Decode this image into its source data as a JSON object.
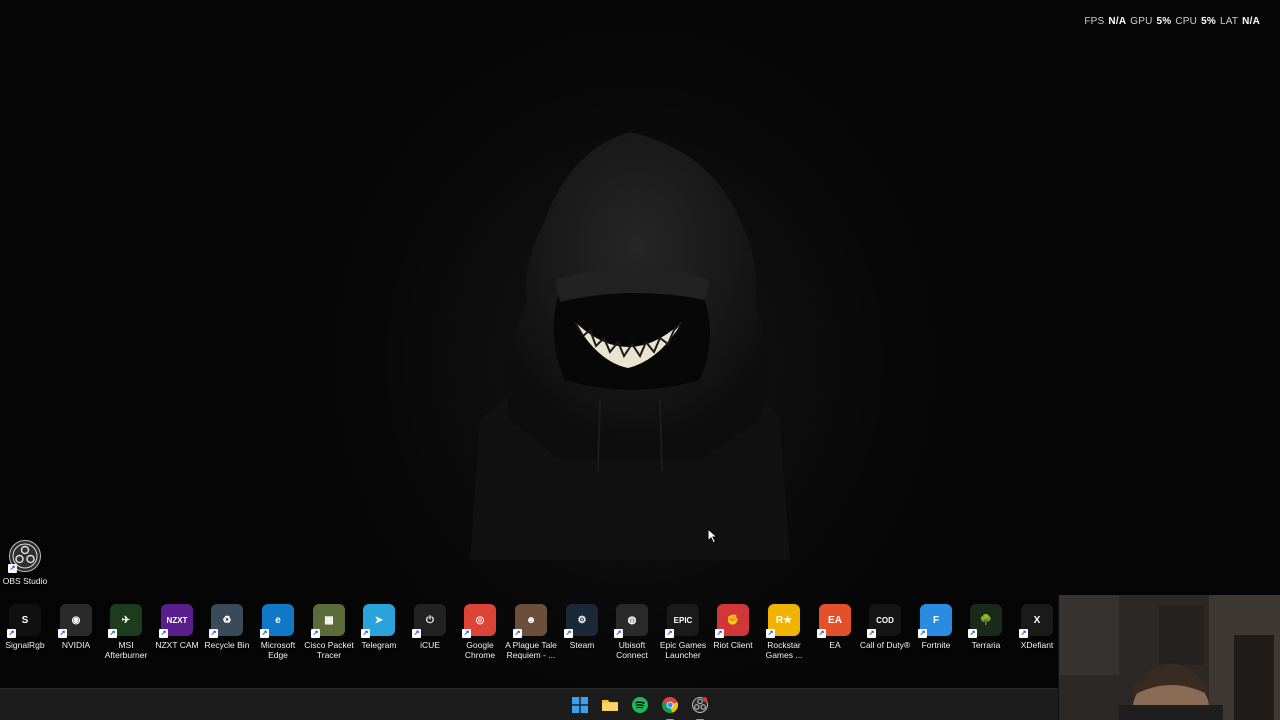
{
  "overlay": {
    "fps_label": "FPS",
    "fps_value": "N/A",
    "gpu_label": "GPU",
    "gpu_value": "5%",
    "cpu_label": "CPU",
    "cpu_value": "5%",
    "lat_label": "LAT",
    "lat_value": "N/A"
  },
  "desktop": {
    "top_icons": [
      {
        "label": "OBS Studio",
        "icon": "obs-icon",
        "color": "#2b2b2b"
      }
    ],
    "icons": [
      {
        "label": "SignalRgb",
        "icon": "signalrgb-icon",
        "color": "#101010",
        "glyph": "S"
      },
      {
        "label": "NVIDIA",
        "icon": "nvidia-icon",
        "color": "#2a2a2a",
        "glyph": "◉"
      },
      {
        "label": "MSI Afterburner",
        "icon": "msi-afterburner-icon",
        "color": "#1d3b1d",
        "glyph": "✈"
      },
      {
        "label": "NZXT CAM",
        "icon": "nzxt-cam-icon",
        "color": "#5a1e8c",
        "glyph": "NZXT"
      },
      {
        "label": "Recycle Bin",
        "icon": "recycle-bin-icon",
        "color": "#3a4a5a",
        "glyph": "♻"
      },
      {
        "label": "Microsoft Edge",
        "icon": "edge-icon",
        "color": "#1178c8",
        "glyph": "e"
      },
      {
        "label": "Cisco Packet Tracer",
        "icon": "cisco-packet-tracer-icon",
        "color": "#5b6b3a",
        "glyph": "▦"
      },
      {
        "label": "Telegram",
        "icon": "telegram-icon",
        "color": "#2aa3dd",
        "glyph": "➤"
      },
      {
        "label": "iCUE",
        "icon": "icue-icon",
        "color": "#222222",
        "glyph": "⏻"
      },
      {
        "label": "Google Chrome",
        "icon": "chrome-icon",
        "color": "#db4437",
        "glyph": "◎"
      },
      {
        "label": "A Plague Tale Requiem - ...",
        "icon": "plague-tale-icon",
        "color": "#6b4f3a",
        "glyph": "☻"
      },
      {
        "label": "Steam",
        "icon": "steam-icon",
        "color": "#1b2838",
        "glyph": "⚙"
      },
      {
        "label": "Ubisoft Connect",
        "icon": "ubisoft-connect-icon",
        "color": "#2a2a2a",
        "glyph": "◍"
      },
      {
        "label": "Epic Games Launcher",
        "icon": "epic-games-icon",
        "color": "#1a1a1a",
        "glyph": "EPIC"
      },
      {
        "label": "Riot Client",
        "icon": "riot-client-icon",
        "color": "#d13639",
        "glyph": "✊"
      },
      {
        "label": "Rockstar Games ...",
        "icon": "rockstar-games-icon",
        "color": "#f0b400",
        "glyph": "R★"
      },
      {
        "label": "EA",
        "icon": "ea-icon",
        "color": "#e4502a",
        "glyph": "EA"
      },
      {
        "label": "Call of Duty®",
        "icon": "call-of-duty-icon",
        "color": "#151515",
        "glyph": "COD"
      },
      {
        "label": "Fortnite",
        "icon": "fortnite-icon",
        "color": "#2a8ce0",
        "glyph": "F"
      },
      {
        "label": "Terraria",
        "icon": "terraria-icon",
        "color": "#1a2a1a",
        "glyph": "🌳"
      },
      {
        "label": "XDefiant",
        "icon": "xdefiant-icon",
        "color": "#1a1a1a",
        "glyph": "X"
      }
    ]
  },
  "taskbar": {
    "items": [
      {
        "icon": "windows-start-icon",
        "color": "#3aa0f0"
      },
      {
        "icon": "file-explorer-icon",
        "color": "#f2c240"
      },
      {
        "icon": "spotify-icon",
        "color": "#1db954"
      },
      {
        "icon": "chrome-icon",
        "color": "#db4437"
      },
      {
        "icon": "obs-icon",
        "color": "#aaaaaa"
      }
    ]
  }
}
